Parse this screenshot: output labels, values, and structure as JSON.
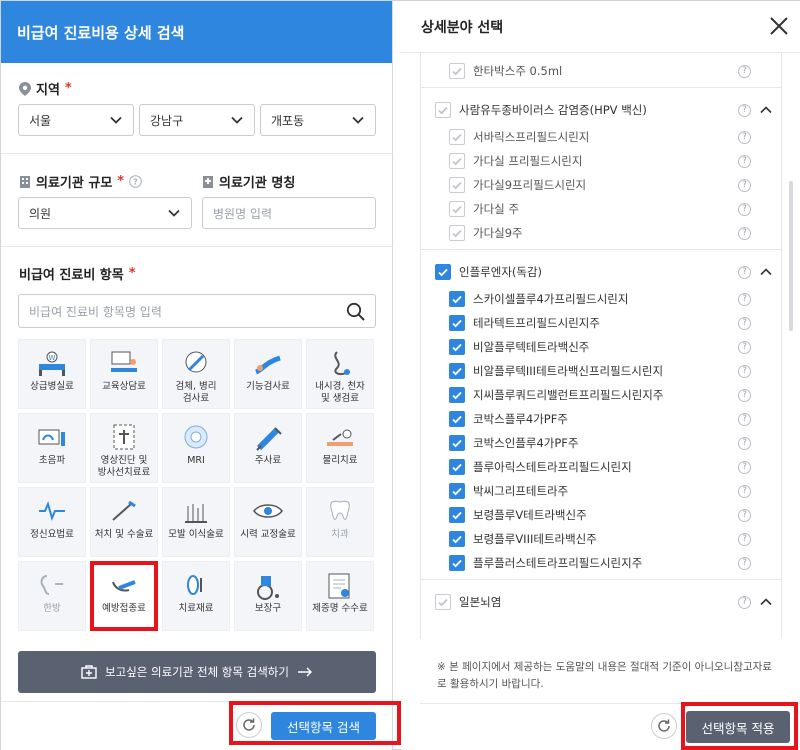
{
  "left": {
    "title": "비급여 진료비용 상세 검색",
    "region": {
      "label": "지역",
      "required": "*",
      "city": "서울",
      "district": "강남구",
      "neighborhood": "개포동"
    },
    "scale": {
      "label": "의료기관 규모",
      "required": "*",
      "value": "의원"
    },
    "name": {
      "label": "의료기관 명칭",
      "placeholder": "병원명 입력"
    },
    "items": {
      "label": "비급여 진료비 항목",
      "required": "*",
      "placeholder": "비급여 진료비 항목명 입력",
      "categories": [
        {
          "label": "상급병실료",
          "icon": "hospital-bed-icon"
        },
        {
          "label": "교육상담료",
          "icon": "consultation-icon"
        },
        {
          "label": "검체, 병리\n검사료",
          "icon": "specimen-test-icon"
        },
        {
          "label": "기능검사료",
          "icon": "function-test-icon"
        },
        {
          "label": "내시경, 천자\n및 생검료",
          "icon": "endoscope-icon"
        },
        {
          "label": "초음파",
          "icon": "ultrasound-icon"
        },
        {
          "label": "영상진단 및\n방사선치료료",
          "icon": "radiology-icon"
        },
        {
          "label": "MRI",
          "icon": "mri-icon"
        },
        {
          "label": "주사료",
          "icon": "syringe-icon"
        },
        {
          "label": "물리치료",
          "icon": "physical-therapy-icon"
        },
        {
          "label": "정신요법료",
          "icon": "psychotherapy-icon"
        },
        {
          "label": "처치 및 수술료",
          "icon": "surgery-icon"
        },
        {
          "label": "모발 이식술료",
          "icon": "hair-transplant-icon"
        },
        {
          "label": "시력 교정술료",
          "icon": "vision-correction-icon"
        },
        {
          "label": "치과",
          "icon": "tooth-icon"
        },
        {
          "label": "한방",
          "icon": "oriental-medicine-icon"
        },
        {
          "label": "예방접종료",
          "icon": "vaccination-icon"
        },
        {
          "label": "치료재료",
          "icon": "treatment-material-icon"
        },
        {
          "label": "보장구",
          "icon": "wheelchair-icon"
        },
        {
          "label": "제증명 수수료",
          "icon": "certificate-icon"
        }
      ]
    },
    "search_all_label": "보고싶은 의료기관 전체 항목 검색하기",
    "search_button": "선택항목 검색"
  },
  "right": {
    "title": "상세분야 선택",
    "rows": [
      {
        "label": "한타박스주 0.5ml",
        "kind": "sub",
        "checked": false
      },
      {
        "label": "사람유두종바이러스 감염증(HPV 백신)",
        "kind": "group",
        "checked": false
      },
      {
        "label": "서바릭스프리필드시린지",
        "kind": "sub",
        "checked": false
      },
      {
        "label": "가다실 프리필드시린지",
        "kind": "sub",
        "checked": false
      },
      {
        "label": "가다실9프리필드시린지",
        "kind": "sub",
        "checked": false
      },
      {
        "label": "가다실 주",
        "kind": "sub",
        "checked": false
      },
      {
        "label": "가다실9주",
        "kind": "sub",
        "checked": false
      },
      {
        "label": "인플루엔자(독감)",
        "kind": "group",
        "checked": true
      },
      {
        "label": "스카이셀플루4가프리필드시린지",
        "kind": "sub",
        "checked": true
      },
      {
        "label": "테라텍트프리필드시린지주",
        "kind": "sub",
        "checked": true
      },
      {
        "label": "비알플루텍테트라백신주",
        "kind": "sub",
        "checked": true
      },
      {
        "label": "비알플루텍III테트라백신프리필드시린지",
        "kind": "sub",
        "checked": true
      },
      {
        "label": "지씨플루쿼드리밸런트프리필드시린지주",
        "kind": "sub",
        "checked": true
      },
      {
        "label": "코박스플루4가PF주",
        "kind": "sub",
        "checked": true
      },
      {
        "label": "코박스인플루4가PF주",
        "kind": "sub",
        "checked": true
      },
      {
        "label": "플루아릭스테트라프리필드시린지",
        "kind": "sub",
        "checked": true
      },
      {
        "label": "박씨그리프테트라주",
        "kind": "sub",
        "checked": true
      },
      {
        "label": "보령플루V테트라백신주",
        "kind": "sub",
        "checked": true
      },
      {
        "label": "보령플루VIII테트라백신주",
        "kind": "sub",
        "checked": true
      },
      {
        "label": "플루플러스테트라프리필드시린지주",
        "kind": "sub",
        "checked": true
      },
      {
        "label": "일본뇌염",
        "kind": "group",
        "checked": false
      }
    ],
    "help_mark": "?",
    "notice": "※ 본 페이지에서 제공하는 도움말의 내용은 절대적 기준이 아니오니참고자료로 활용하시기 바랍니다.",
    "apply_button": "선택항목 적용"
  },
  "colors": {
    "primary": "#2e86de",
    "dark_button": "#5a6272",
    "highlight": "#e8141b"
  }
}
